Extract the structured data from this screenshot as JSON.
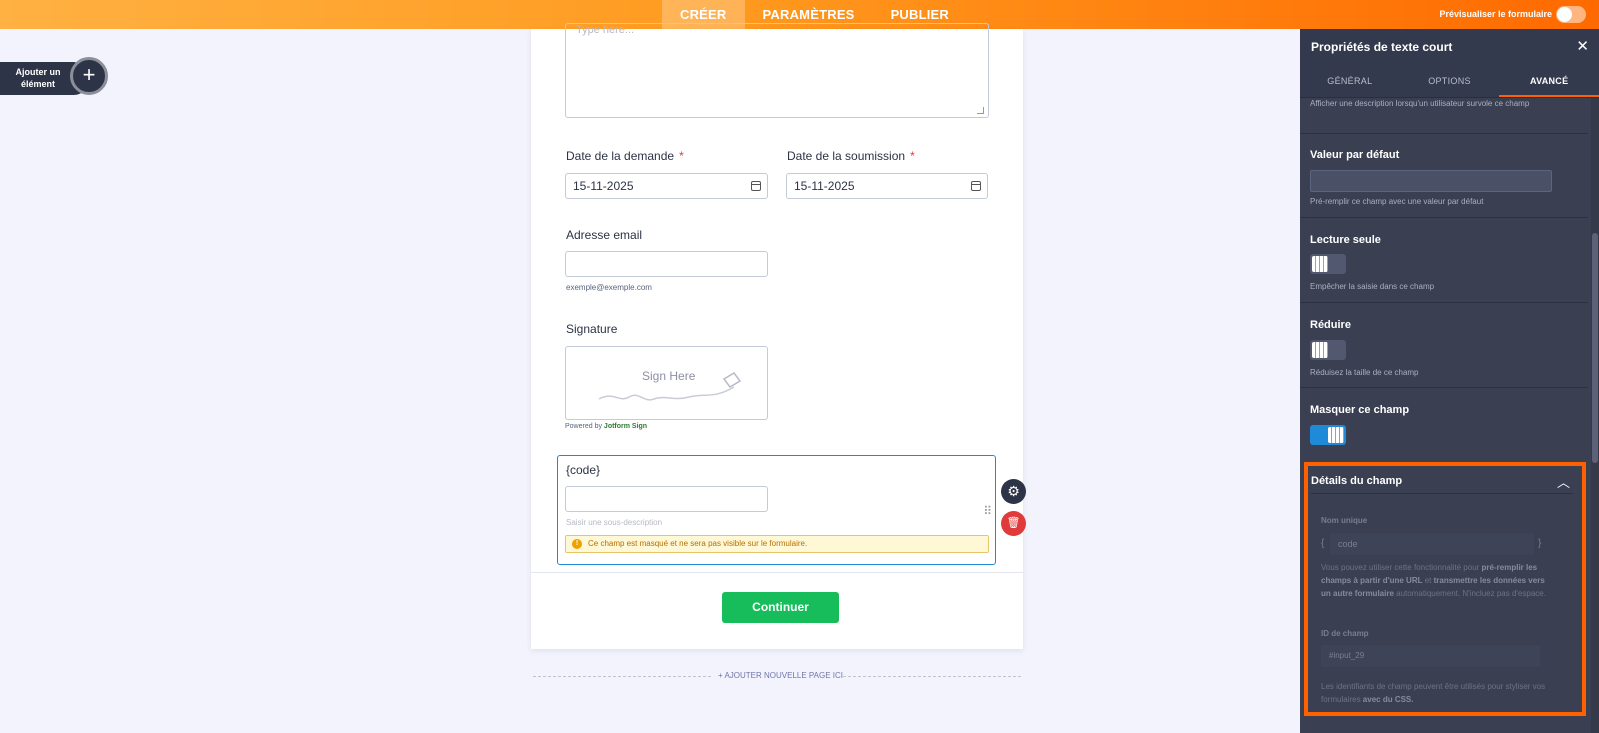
{
  "topbar": {
    "tabs": [
      "CRÉER",
      "PARAMÈTRES",
      "PUBLIER"
    ],
    "preview_label": "Prévisualiser le formulaire"
  },
  "add_element": {
    "label": "Ajouter un élément",
    "plus": "+"
  },
  "form": {
    "textarea_placeholder": "Type here...",
    "date_request_label": "Date de la demande",
    "date_submit_label": "Date de la soumission",
    "required_mark": "*",
    "date_request_value": "15-11-2025",
    "date_submit_value": "15-11-2025",
    "email_label": "Adresse email",
    "email_sublabel": "exemple@exemple.com",
    "signature_label": "Signature",
    "signature_placeholder": "Sign Here",
    "powered_prefix": "Powered by",
    "powered_brand": "Jotform Sign",
    "code_label": "{code}",
    "code_sublabel": "Saisir une sous-description",
    "hidden_warning": "Ce champ est masqué et ne sera pas visible sur le formulaire.",
    "warning_icon": "!",
    "continue_button": "Continuer",
    "add_page": "+ AJOUTER NOUVELLE PAGE ICI"
  },
  "panel": {
    "title": "Propriétés de texte court",
    "close": "✕",
    "tabs": [
      "GÉNÉRAL",
      "OPTIONS",
      "AVANCÉ"
    ],
    "hover_desc": "Afficher une description lorsqu'un utilisateur survole ce champ",
    "default_value_title": "Valeur par défaut",
    "default_value_desc": "Pré-remplir ce champ avec une valeur par défaut",
    "readonly_title": "Lecture seule",
    "readonly_desc": "Empêcher la saisie dans ce champ",
    "shrink_title": "Réduire",
    "shrink_desc": "Réduisez la taille de ce champ",
    "hide_title": "Masquer ce champ",
    "toggles": {
      "readonly": false,
      "shrink": false,
      "hide": true
    },
    "details": {
      "title": "Détails du champ",
      "unique_name_label": "Nom unique",
      "unique_name_value": "code",
      "brace_open": "{",
      "brace_close": "}",
      "unique_desc_1": "Vous pouvez utiliser cette fonctionnalité pour ",
      "unique_desc_bold_1": "pré-remplir les champs à partir d'une URL",
      "unique_desc_2": " et ",
      "unique_desc_bold_2": "transmettre les données vers un autre formulaire",
      "unique_desc_3": " automatiquement. N'incluez pas d'espace.",
      "field_id_label": "ID de champ",
      "field_id_value": "#input_29",
      "id_desc_1": "Les identifiants de champ peuvent être utilisés pour styliser vos formulaires ",
      "id_desc_bold": "avec du CSS."
    }
  },
  "colors": {
    "accent": "#ff6100",
    "blue": "#1e8ad8",
    "green": "#18bd5b",
    "danger": "#e03a3a",
    "panel": "#3a3f52"
  }
}
